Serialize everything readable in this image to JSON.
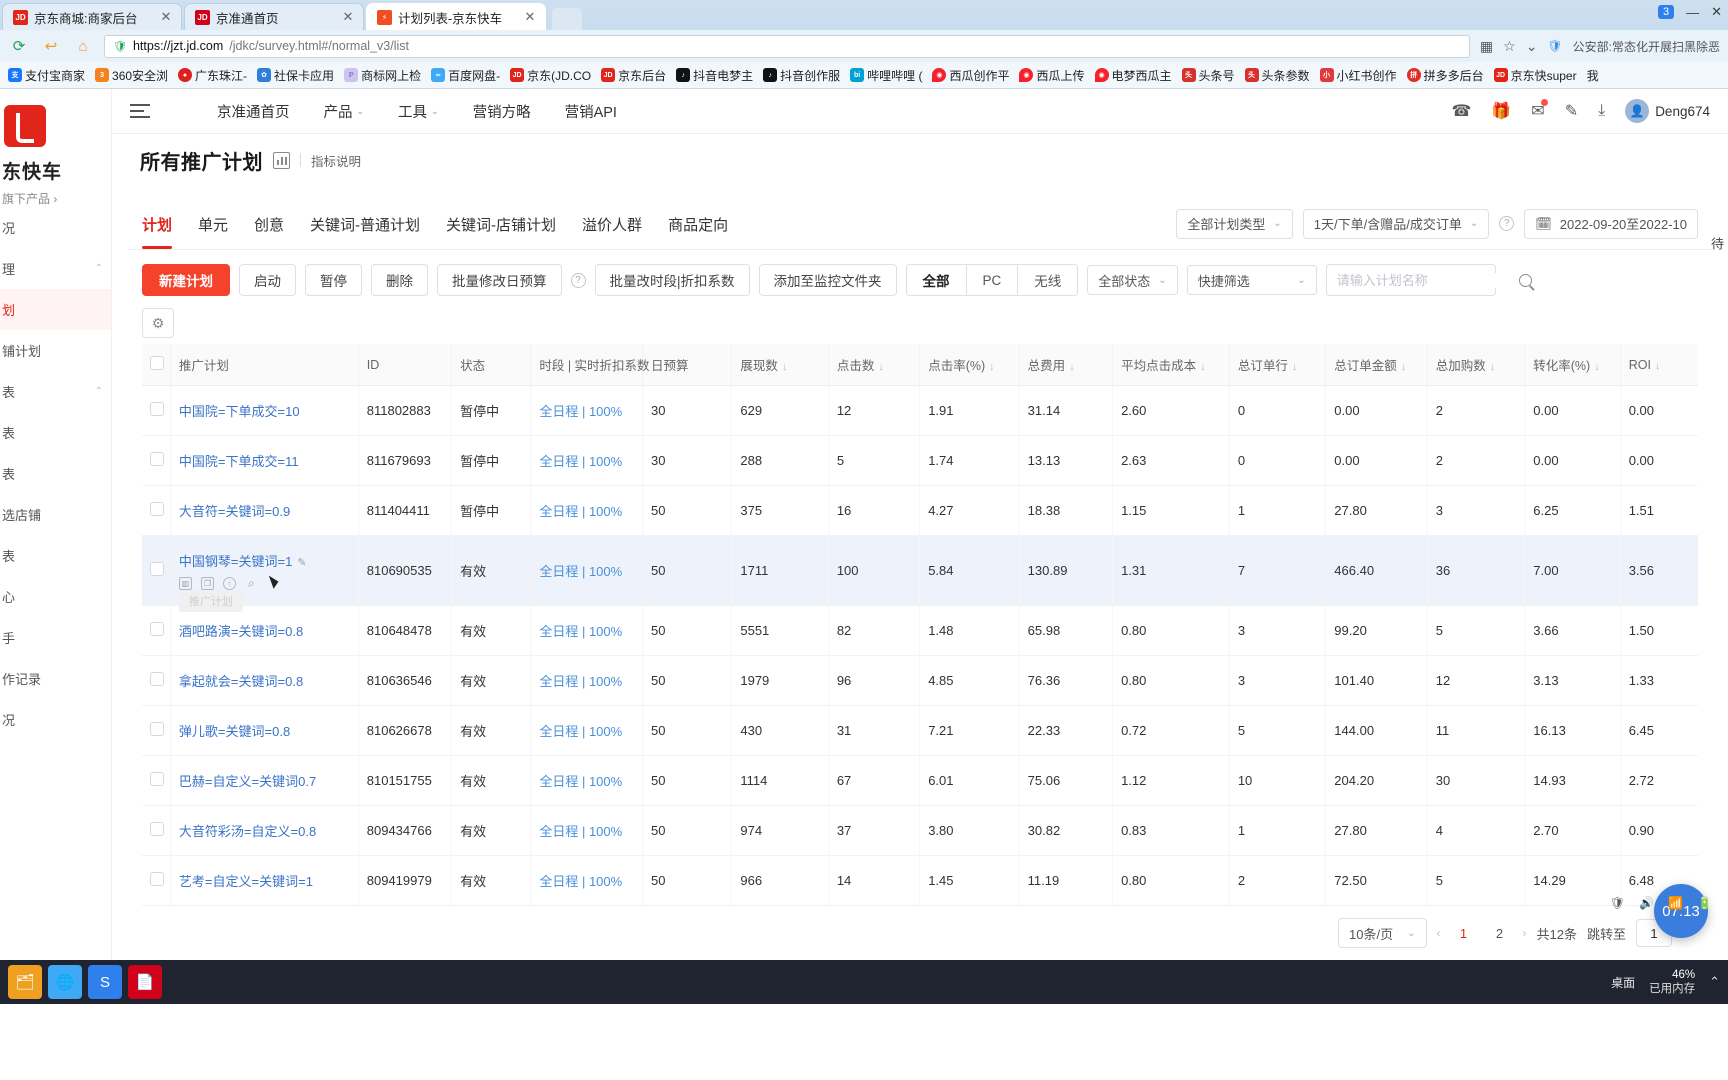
{
  "browser": {
    "tabs": [
      {
        "label": "京东商城:商家后台",
        "favicon": "jd-icon",
        "active": false
      },
      {
        "label": "京准通首页",
        "favicon": "jd-icon",
        "active": false
      },
      {
        "label": "计划列表-京东快车",
        "favicon": "express-icon",
        "active": true
      }
    ],
    "window_badge": "3",
    "url_host": "https://jzt.jd.com",
    "url_path": "/jdkc/survey.html#/normal_v3/list",
    "url_full": "https://jzt.jd.com/jdkc/survey.html#/normal_v3/list",
    "nav_right_text": "公安部:常态化开展扫黑除恶",
    "bookmarks": [
      {
        "label": "支付宝商家",
        "color": "#1677ff"
      },
      {
        "label": "360安全浏",
        "color": "#f58220"
      },
      {
        "label": "广东珠江-",
        "color": "#e01f1f"
      },
      {
        "label": "社保卡应用",
        "color": "#2f7ed8"
      },
      {
        "label": "商标网上检",
        "color": "#9b8ad6"
      },
      {
        "label": "百度网盘-",
        "color": "#3fa9f5"
      },
      {
        "label": "京东(JD.CO",
        "color": "#e1251b"
      },
      {
        "label": "京东后台",
        "color": "#e1251b"
      },
      {
        "label": "抖音电梦主",
        "color": "#111111"
      },
      {
        "label": "抖音创作服",
        "color": "#111111"
      },
      {
        "label": "哔哩哔哩 (",
        "color": "#00a1d6"
      },
      {
        "label": "西瓜创作平",
        "color": "#f5222d"
      },
      {
        "label": "西瓜上传",
        "color": "#f5222d"
      },
      {
        "label": "电梦西瓜主",
        "color": "#f5222d"
      },
      {
        "label": "头条号",
        "color": "#d9302b"
      },
      {
        "label": "头条参数",
        "color": "#d9302b"
      },
      {
        "label": "小红书创作",
        "color": "#e23a3a"
      },
      {
        "label": "拼多多后台",
        "color": "#e02e24"
      },
      {
        "label": "京东快super",
        "color": "#e1251b"
      },
      {
        "label": "我",
        "color": "#888888"
      }
    ]
  },
  "left_rail": {
    "brand": "东快车",
    "sub": "旗下产品",
    "items": [
      {
        "label": "况",
        "active": false
      },
      {
        "label": "理",
        "active": false,
        "chev": "⌃"
      },
      {
        "label": "划",
        "active": true
      },
      {
        "label": "铺计划",
        "active": false
      },
      {
        "label": "表",
        "active": false,
        "chev": "⌃"
      },
      {
        "label": "表",
        "active": false
      },
      {
        "label": "表",
        "active": false
      },
      {
        "label": "选店铺",
        "active": false
      },
      {
        "label": "表",
        "active": false
      },
      {
        "label": "心",
        "active": false
      },
      {
        "label": "手",
        "active": false
      },
      {
        "label": "作记录",
        "active": false
      },
      {
        "label": "况",
        "active": false
      }
    ]
  },
  "topnav": {
    "menu_icon": "hamburger-icon",
    "items": [
      {
        "label": "京准通首页",
        "caret": false
      },
      {
        "label": "产品",
        "caret": true
      },
      {
        "label": "工具",
        "caret": true
      },
      {
        "label": "营销方略",
        "caret": false
      },
      {
        "label": "营销API",
        "caret": false
      }
    ],
    "icons": [
      "phone-icon",
      "gift-icon",
      "mail-icon",
      "edit-icon",
      "download-icon"
    ],
    "user": "Deng674"
  },
  "pagehead": {
    "title": "所有推广计划",
    "chart_icon": "bar-chart-icon",
    "metric_link": "指标说明"
  },
  "tabs": [
    {
      "label": "计划",
      "selected": true
    },
    {
      "label": "单元",
      "selected": false
    },
    {
      "label": "创意",
      "selected": false
    },
    {
      "label": "关键词-普通计划",
      "selected": false
    },
    {
      "label": "关键词-店铺计划",
      "selected": false
    },
    {
      "label": "溢价人群",
      "selected": false
    },
    {
      "label": "商品定向",
      "selected": false
    }
  ],
  "filters": {
    "plan_type": "全部计划类型",
    "attribution": "1天/下单/含赠品/成交订单",
    "date_range": "2022-09-20至2022-10"
  },
  "toolbar": {
    "new_plan": "新建计划",
    "start": "启动",
    "pause": "暂停",
    "delete": "删除",
    "batch_budget": "批量修改日预算",
    "batch_schedule": "批量改时段|折扣系数",
    "add_monitor": "添加至监控文件夹",
    "seg_all": "全部",
    "seg_pc": "PC",
    "seg_wireless": "无线",
    "status_filter": "全部状态",
    "quick_filter": "快捷筛选",
    "search_placeholder": "请输入计划名称",
    "search_value": "",
    "gear_icon": "gear-icon"
  },
  "table": {
    "columns": [
      {
        "key": "cb",
        "label": "",
        "sort": false,
        "cls": "col-cb"
      },
      {
        "key": "plan",
        "label": "推广计划",
        "sort": false,
        "cls": "col-plan"
      },
      {
        "key": "id",
        "label": "ID",
        "sort": false,
        "cls": "col-id"
      },
      {
        "key": "status",
        "label": "状态",
        "sort": false,
        "cls": "col-st"
      },
      {
        "key": "schedule",
        "label": "时段 | 实时折扣系数",
        "sort": false,
        "cls": "col-sched"
      },
      {
        "key": "budget",
        "label": "日预算",
        "sort": false,
        "cls": "col-budget"
      },
      {
        "key": "impressions",
        "label": "展现数",
        "sort": true,
        "cls": "col-imp"
      },
      {
        "key": "clicks",
        "label": "点击数",
        "sort": true,
        "cls": "col-clk"
      },
      {
        "key": "ctr",
        "label": "点击率(%)",
        "sort": true,
        "cls": "col-ctr"
      },
      {
        "key": "cost",
        "label": "总费用",
        "sort": true,
        "cls": "col-cost"
      },
      {
        "key": "cpc",
        "label": "平均点击成本",
        "sort": true,
        "cls": "col-cpc"
      },
      {
        "key": "orders",
        "label": "总订单行",
        "sort": true,
        "cls": "col-ord"
      },
      {
        "key": "amount",
        "label": "总订单金额",
        "sort": true,
        "cls": "col-amt"
      },
      {
        "key": "carts",
        "label": "总加购数",
        "sort": true,
        "cls": "col-cart"
      },
      {
        "key": "cvr",
        "label": "转化率(%)",
        "sort": true,
        "cls": "col-cvr"
      },
      {
        "key": "roi",
        "label": "ROI",
        "sort": true,
        "cls": "col-roi"
      }
    ],
    "sort_glyph": "↓",
    "rows": [
      {
        "plan": "中国院=下单成交=10",
        "id": "811802883",
        "status": "暂停中",
        "schedule": "全日程 | 100%",
        "budget": "30",
        "impressions": "629",
        "clicks": "12",
        "ctr": "1.91",
        "cost": "31.14",
        "cpc": "2.60",
        "orders": "0",
        "amount": "0.00",
        "carts": "2",
        "cvr": "0.00",
        "roi": "0.00",
        "highlight": false,
        "hovered": false
      },
      {
        "plan": "中国院=下单成交=11",
        "id": "811679693",
        "status": "暂停中",
        "schedule": "全日程 | 100%",
        "budget": "30",
        "impressions": "288",
        "clicks": "5",
        "ctr": "1.74",
        "cost": "13.13",
        "cpc": "2.63",
        "orders": "0",
        "amount": "0.00",
        "carts": "2",
        "cvr": "0.00",
        "roi": "0.00",
        "highlight": false,
        "hovered": false
      },
      {
        "plan": "大音符=关键词=0.9",
        "id": "811404411",
        "status": "暂停中",
        "schedule": "全日程 | 100%",
        "budget": "50",
        "impressions": "375",
        "clicks": "16",
        "ctr": "4.27",
        "cost": "18.38",
        "cpc": "1.15",
        "orders": "1",
        "amount": "27.80",
        "carts": "3",
        "cvr": "6.25",
        "roi": "1.51",
        "highlight": false,
        "hovered": false
      },
      {
        "plan": "中国钢琴=关键词=1",
        "id": "810690535",
        "status": "有效",
        "schedule": "全日程 | 100%",
        "budget": "50",
        "impressions": "1711",
        "clicks": "100",
        "ctr": "5.84",
        "cost": "130.89",
        "cpc": "1.31",
        "orders": "7",
        "amount": "466.40",
        "carts": "36",
        "cvr": "7.00",
        "roi": "3.56",
        "highlight": true,
        "hovered": true
      },
      {
        "plan": "酒吧路演=关键词=0.8",
        "id": "810648478",
        "status": "有效",
        "schedule": "全日程 | 100%",
        "budget": "50",
        "impressions": "5551",
        "clicks": "82",
        "ctr": "1.48",
        "cost": "65.98",
        "cpc": "0.80",
        "orders": "3",
        "amount": "99.20",
        "carts": "5",
        "cvr": "3.66",
        "roi": "1.50",
        "highlight": false,
        "hovered": false
      },
      {
        "plan": "拿起就会=关键词=0.8",
        "id": "810636546",
        "status": "有效",
        "schedule": "全日程 | 100%",
        "budget": "50",
        "impressions": "1979",
        "clicks": "96",
        "ctr": "4.85",
        "cost": "76.36",
        "cpc": "0.80",
        "orders": "3",
        "amount": "101.40",
        "carts": "12",
        "cvr": "3.13",
        "roi": "1.33",
        "highlight": false,
        "hovered": false
      },
      {
        "plan": "弹儿歌=关键词=0.8",
        "id": "810626678",
        "status": "有效",
        "schedule": "全日程 | 100%",
        "budget": "50",
        "impressions": "430",
        "clicks": "31",
        "ctr": "7.21",
        "cost": "22.33",
        "cpc": "0.72",
        "orders": "5",
        "amount": "144.00",
        "carts": "11",
        "cvr": "16.13",
        "roi": "6.45",
        "highlight": false,
        "hovered": false
      },
      {
        "plan": "巴赫=自定义=关键词0.7",
        "id": "810151755",
        "status": "有效",
        "schedule": "全日程 | 100%",
        "budget": "50",
        "impressions": "1114",
        "clicks": "67",
        "ctr": "6.01",
        "cost": "75.06",
        "cpc": "1.12",
        "orders": "10",
        "amount": "204.20",
        "carts": "30",
        "cvr": "14.93",
        "roi": "2.72",
        "highlight": false,
        "hovered": false
      },
      {
        "plan": "大音符彩汤=自定义=0.8",
        "id": "809434766",
        "status": "有效",
        "schedule": "全日程 | 100%",
        "budget": "50",
        "impressions": "974",
        "clicks": "37",
        "ctr": "3.80",
        "cost": "30.82",
        "cpc": "0.83",
        "orders": "1",
        "amount": "27.80",
        "carts": "4",
        "cvr": "2.70",
        "roi": "0.90",
        "highlight": false,
        "hovered": false
      },
      {
        "plan": "艺考=自定义=关键词=1",
        "id": "809419979",
        "status": "有效",
        "schedule": "全日程 | 100%",
        "budget": "50",
        "impressions": "966",
        "clicks": "14",
        "ctr": "1.45",
        "cost": "11.19",
        "cpc": "0.80",
        "orders": "2",
        "amount": "72.50",
        "carts": "5",
        "cvr": "14.29",
        "roi": "6.48",
        "highlight": false,
        "hovered": false
      }
    ],
    "row_action_icons": [
      "report-icon",
      "copy-icon",
      "promote-icon",
      "search-word-icon"
    ],
    "row_tooltip": "推广计划",
    "edit_icon": "pencil-icon"
  },
  "pagination": {
    "page_size": "10条/页",
    "pages": [
      "1",
      "2"
    ],
    "current_page": "1",
    "total": "共12条",
    "jump_label": "跳转至",
    "jump_value": "1",
    "prev_glyph": "‹",
    "next_glyph": "›"
  },
  "float_clock": "07:13",
  "taskbar": {
    "apps": [
      "files-icon",
      "browser-icon",
      "snipaste-icon",
      "pdf-icon"
    ],
    "desktop_label": "桌面",
    "mem_label": "已用内存",
    "mem_value": "46%",
    "tray": [
      "shield-icon",
      "speaker-icon",
      "network-icon",
      "battery-icon",
      "clock-icon"
    ]
  }
}
